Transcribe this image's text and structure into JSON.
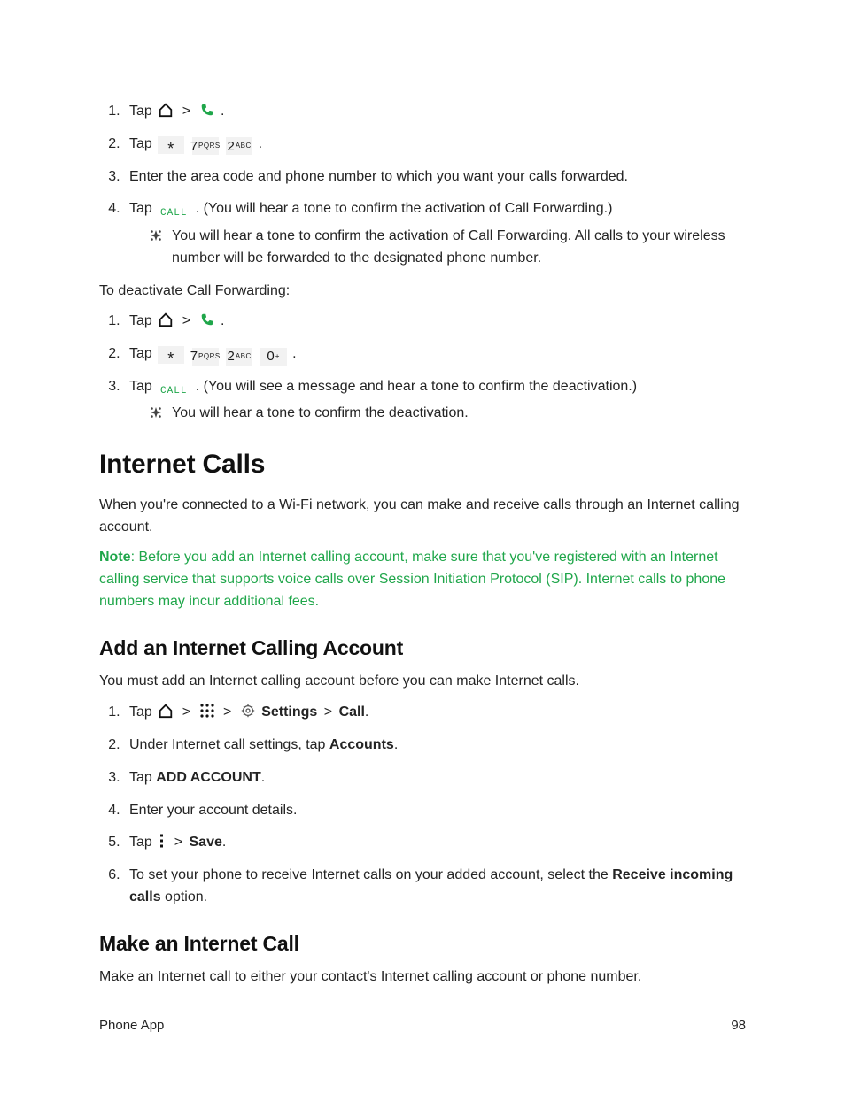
{
  "activate": {
    "step1_tap": "Tap",
    "step2_tap": "Tap",
    "step3": "Enter the area code and phone number to which you want your calls forwarded.",
    "step4_a": "Tap ",
    "step4_b": " . (You will hear a tone to confirm the activation of Call Forwarding.)",
    "tip": "You will hear a tone to confirm the activation of Call Forwarding. All calls to your wireless number will be forwarded to the designated phone number."
  },
  "deactivate_intro": "To deactivate Call Forwarding:",
  "deactivate": {
    "step1_tap": "Tap",
    "step2_tap": "Tap",
    "step3_a": "Tap ",
    "step3_b": " . (You will see a message and hear a tone to confirm the deactivation.)",
    "tip": "You will hear a tone to confirm the deactivation."
  },
  "internet_calls": {
    "heading": "Internet Calls",
    "intro": "When you're connected to a Wi-Fi network, you can make and receive calls through an Internet calling account.",
    "note_label": "Note",
    "note_body": ": Before you add an Internet calling account, make sure that you've registered with an Internet calling service that supports voice calls over Session Initiation Protocol (SIP). Internet calls to phone numbers may incur additional fees."
  },
  "add_account": {
    "heading": "Add an Internet Calling Account",
    "intro": "You must add an Internet calling account before you can make Internet calls.",
    "step1_a": "Tap",
    "step1_settings": "Settings",
    "step1_call": "Call",
    "step2_a": "Under Internet call settings, tap ",
    "step2_b": "Accounts",
    "step3_a": "Tap ",
    "step3_b": "ADD ACCOUNT",
    "step4": "Enter your account details.",
    "step5_a": "Tap",
    "step5_b": "Save",
    "step6_a": "To set your phone to receive Internet calls on your added account, select the ",
    "step6_b": "Receive incoming calls",
    "step6_c": " option."
  },
  "make_call": {
    "heading": "Make an Internet Call",
    "intro": "Make an Internet call to either your contact's Internet calling account or phone number."
  },
  "keys": {
    "star": "*",
    "seven": "7",
    "seven_label": "PQRS",
    "two": "2",
    "two_label": "ABC",
    "zero": "0",
    "zero_label": "+",
    "call": "CALL"
  },
  "footer": {
    "section": "Phone App",
    "page": "98"
  },
  "sep": ">",
  "dot": "."
}
